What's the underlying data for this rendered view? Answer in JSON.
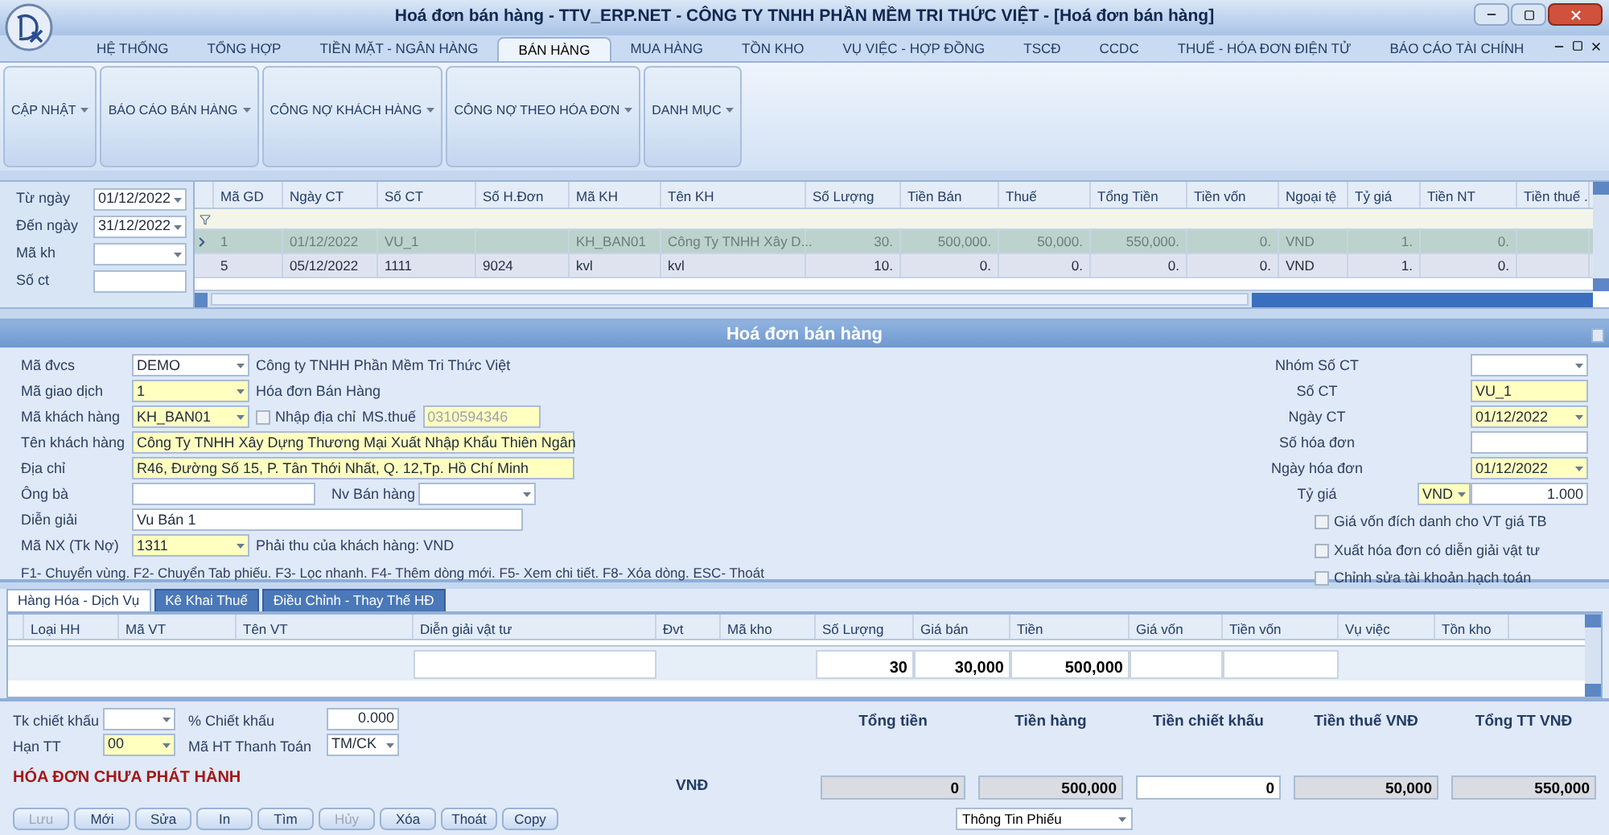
{
  "window": {
    "title": "Hoá đơn bán hàng - TTV_ERP.NET - CÔNG TY TNHH PHẦN MỀM TRI THỨC VIỆT - [Hoá đơn bán hàng]"
  },
  "menu_tabs": [
    {
      "label": "HỆ THỐNG",
      "selected": false
    },
    {
      "label": "TỔNG HỢP",
      "selected": false
    },
    {
      "label": "TIỀN MẶT - NGÂN HÀNG",
      "selected": false
    },
    {
      "label": "BÁN HÀNG",
      "selected": true
    },
    {
      "label": "MUA HÀNG",
      "selected": false
    },
    {
      "label": "TỒN KHO",
      "selected": false
    },
    {
      "label": "VỤ VIỆC - HỢP ĐỒNG",
      "selected": false
    },
    {
      "label": "TSCĐ",
      "selected": false
    },
    {
      "label": "CCDC",
      "selected": false
    },
    {
      "label": "THUẾ - HÓA ĐƠN ĐIỆN TỬ",
      "selected": false
    },
    {
      "label": "BÁO CÁO TÀI CHÍNH",
      "selected": false
    }
  ],
  "ribbon_groups": [
    "CẬP NHẬT",
    "BÁO CÁO BÁN HÀNG",
    "CÔNG NỢ KHÁCH HÀNG",
    "CÔNG NỢ THEO HÓA ĐƠN",
    "DANH MỤC"
  ],
  "filter": [
    {
      "label": "Từ ngày",
      "value": "01/12/2022",
      "kind": "combo"
    },
    {
      "label": "Đến ngày",
      "value": "31/12/2022",
      "kind": "combo"
    },
    {
      "label": "Mã kh",
      "kind": "combo"
    },
    {
      "label": "Số ct",
      "kind": "text"
    }
  ],
  "list": {
    "columns": [
      "Mã GD",
      "Ngày CT",
      "Số CT",
      "Số H.Đơn",
      "Mã KH",
      "Tên KH",
      "Số Lượng",
      "Tiền Bán",
      "Thuế",
      "Tổng Tiền",
      "Tiền vốn",
      "Ngoại tệ",
      "Tỷ giá",
      "Tiền NT",
      "Tiền thuế ."
    ],
    "rows": [
      {
        "selected": true,
        "cells": [
          "1",
          "01/12/2022",
          "VU_1",
          null,
          "KH_BAN01",
          "Công Ty TNHH Xây D...",
          "30.",
          "500,000.",
          "50,000.",
          "550,000.",
          "0.",
          "VND",
          "1.",
          "0."
        ]
      },
      {
        "selected": false,
        "cells": [
          "5",
          "05/12/2022",
          "1111",
          "9024",
          "kvl",
          "kvl",
          "10.",
          "0.",
          "0.",
          "0.",
          "0.",
          "VND",
          "1.",
          "0."
        ]
      }
    ]
  },
  "form": {
    "title": "Hoá đơn bán hàng",
    "left": [
      {
        "kind": "combo",
        "label": "Mã đvcs",
        "value": "DEMO",
        "required": false,
        "note": "Công ty TNHH Phần Mềm Tri Thức Việt"
      },
      {
        "kind": "combo",
        "label": "Mã giao dịch",
        "value": "1",
        "required": true,
        "note": "Hóa đơn Bán Hàng"
      },
      {
        "kind": "customer",
        "label": "Mã khách hàng",
        "value": "KH_BAN01",
        "required": true,
        "checkbox": {
          "label": "Nhập địa chỉ",
          "checked": false
        },
        "tax_label": "MS.thuế",
        "tax_value": "0310594346"
      },
      {
        "kind": "wide",
        "label": "Tên khách hàng",
        "value": "Công Ty TNHH Xây Dựng Thương Mại Xuất Nhập Khẩu Thiên Ngân",
        "required": true
      },
      {
        "kind": "wide",
        "label": "Địa chỉ",
        "value": "R46, Đường Số 15, P. Tân Thới Nhất, Q. 12,Tp. Hồ Chí Minh",
        "required": true
      },
      {
        "kind": "contact",
        "label": "Ông bà",
        "side_label": "Nv Bán hàng"
      },
      {
        "kind": "full",
        "label": "Diễn giải",
        "value": "Vu Bán 1",
        "required": false
      },
      {
        "kind": "combo",
        "label": "Mã NX (Tk Nợ)",
        "value": "1311",
        "required": true,
        "note": "Phải thu của khách hàng: VND"
      }
    ],
    "hint": "F1- Chuyển vùng. F2- Chuyển Tab phiếu. F3- Lọc nhanh. F4- Thêm dòng mới. F5- Xem chi tiết. F8- Xóa dòng. ESC- Thoát",
    "right": [
      {
        "kind": "combo",
        "label": "Nhóm Số CT",
        "required": false
      },
      {
        "kind": "text",
        "label": "Số CT",
        "value": "VU_1",
        "required": true
      },
      {
        "kind": "combo",
        "label": "Ngày CT",
        "value": "01/12/2022",
        "required": true
      },
      {
        "kind": "text",
        "label": "Số hóa đơn",
        "required": false
      },
      {
        "kind": "combo",
        "label": "Ngày hóa đơn",
        "value": "01/12/2022",
        "required": true
      },
      {
        "kind": "rate",
        "label": "Tỷ giá",
        "currency": "VND",
        "value": "1.000",
        "required": true
      }
    ],
    "checkboxes": [
      {
        "label": "Giá vốn đích danh cho VT giá TB",
        "checked": false
      },
      {
        "label": "Xuất hóa đơn có diễn giải vật tư",
        "checked": false
      },
      {
        "label": "Chỉnh sửa tài khoản hạch toán",
        "checked": false
      }
    ]
  },
  "detail": {
    "tabs": [
      {
        "label": "Hàng Hóa - Dịch Vụ",
        "selected": true
      },
      {
        "label": "Kê Khai Thuế",
        "selected": false
      },
      {
        "label": "Điều Chỉnh - Thay Thế HĐ",
        "selected": false
      }
    ],
    "columns": [
      "Loại HH",
      "Mã VT",
      "Tên VT",
      "Diễn giải vật tư",
      "Đvt",
      "Mã kho",
      "Số Lượng",
      "Giá bán",
      "Tiền",
      "Giá vốn",
      "Tiền vốn",
      "Vụ việc",
      "Tồn kho"
    ],
    "totals": {
      "quantity": "30",
      "price": "30,000",
      "amount": "500,000"
    }
  },
  "footer": {
    "fields": [
      {
        "label": "Tk chiết khấu",
        "kind": "combo",
        "required": false
      },
      {
        "label": "% Chiết khấu",
        "kind": "number",
        "value": "0.000",
        "required": false
      },
      {
        "label": "Hạn TT",
        "kind": "combo",
        "value": "00",
        "required": true
      },
      {
        "label": "Mã HT Thanh Toán",
        "kind": "combo",
        "value": "TM/CK",
        "required": false
      }
    ],
    "status": "HÓA ĐƠN CHƯA PHÁT HÀNH",
    "currency": "VNĐ",
    "totals": [
      {
        "label": "Tổng tiền",
        "value": "0",
        "readonly": true
      },
      {
        "label": "Tiền hàng",
        "value": "500,000",
        "readonly": true
      },
      {
        "label": "Tiền chiết khấu",
        "value": "0",
        "readonly": false
      },
      {
        "label": "Tiền thuế VNĐ",
        "value": "50,000",
        "readonly": true
      },
      {
        "label": "Tổng TT VNĐ",
        "value": "550,000",
        "readonly": true
      }
    ],
    "buttons": [
      {
        "label": "Lưu",
        "disabled": true
      },
      {
        "label": "Mới",
        "disabled": false
      },
      {
        "label": "Sửa",
        "disabled": false
      },
      {
        "label": "In",
        "disabled": false
      },
      {
        "label": "Tìm",
        "disabled": false
      },
      {
        "label": "Hủy",
        "disabled": true
      },
      {
        "label": "Xóa",
        "disabled": false
      },
      {
        "label": "Thoát",
        "disabled": false
      },
      {
        "label": "Copy",
        "disabled": false
      }
    ],
    "view_select": "Thông Tin Phiếu"
  }
}
